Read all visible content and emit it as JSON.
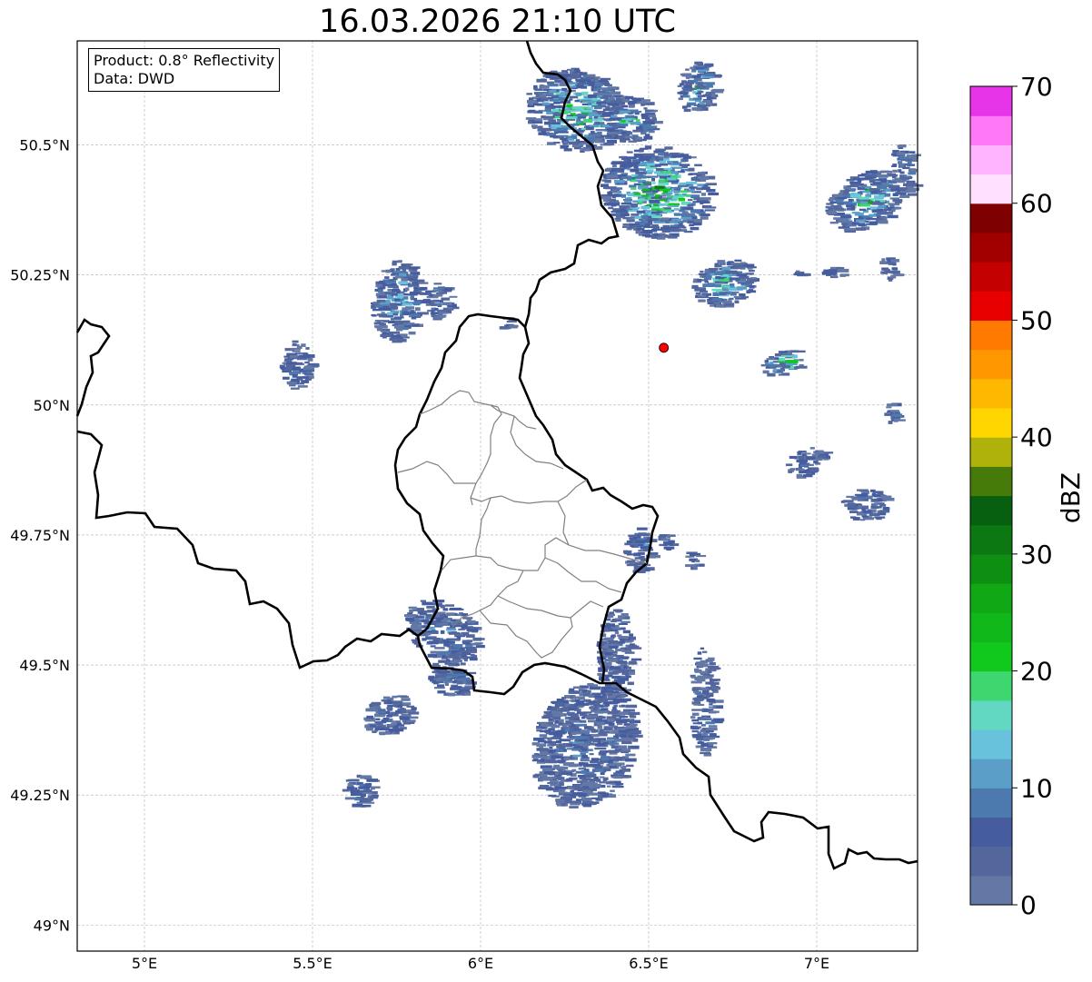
{
  "title": "16.03.2026 21:10 UTC",
  "info": {
    "product": "Product: 0.8° Reflectivity",
    "source": "Data: DWD"
  },
  "axes": {
    "lon_ticks": [
      "5°E",
      "5.5°E",
      "6°E",
      "6.5°E",
      "7°E"
    ],
    "lat_ticks": [
      "49°N",
      "49.25°N",
      "49.5°N",
      "49.75°N",
      "50°N",
      "50.25°N",
      "50.5°N"
    ],
    "lon_range": [
      4.8,
      7.3
    ],
    "lat_range": [
      48.95,
      50.7
    ]
  },
  "colorbar": {
    "label": "dBZ",
    "ticks": [
      "0",
      "10",
      "20",
      "30",
      "40",
      "50",
      "60",
      "70"
    ],
    "range": [
      0,
      70
    ],
    "colors": [
      "#6478a6",
      "#53679d",
      "#455c9f",
      "#4c79ae",
      "#5b9fc8",
      "#68c2dc",
      "#62d7c2",
      "#3dd66f",
      "#11c81c",
      "#11b81a",
      "#10a814",
      "#0e8f12",
      "#0c7811",
      "#076010",
      "#467b0a",
      "#aeb20a",
      "#ffd600",
      "#ffb800",
      "#ff9800",
      "#ff7a00",
      "#e80000",
      "#c40000",
      "#a20000",
      "#7e0000",
      "#ffe0ff",
      "#ffb4ff",
      "#ff78f6",
      "#e834e8"
    ]
  },
  "marker": {
    "lon": 6.545,
    "lat": 50.11,
    "color": "#ff0000"
  },
  "colors": {
    "border_national": "#000000",
    "border_regional": "#808080",
    "grid": "#b0b0b0"
  }
}
